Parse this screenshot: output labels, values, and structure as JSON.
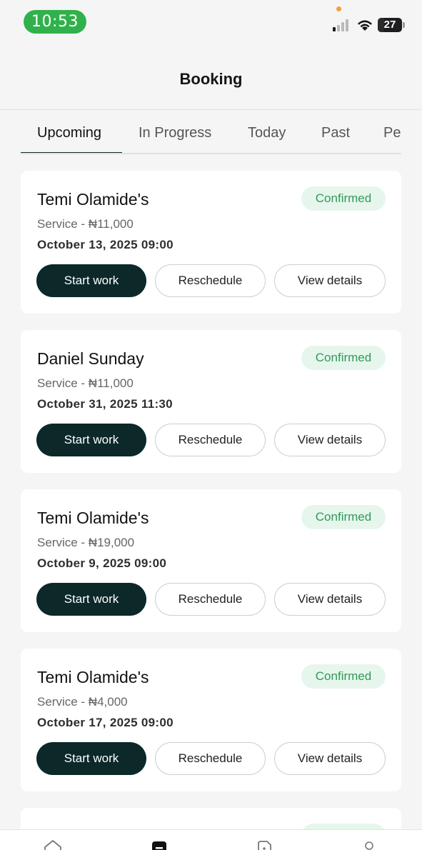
{
  "status_bar": {
    "time": "10:53",
    "battery": "27",
    "battery_fraction": 0.27
  },
  "header": {
    "title": "Booking"
  },
  "tabs": [
    {
      "label": "Upcoming",
      "active": true
    },
    {
      "label": "In Progress",
      "active": false
    },
    {
      "label": "Today",
      "active": false
    },
    {
      "label": "Past",
      "active": false
    },
    {
      "label": "Pending",
      "active": false
    }
  ],
  "bookings": [
    {
      "name": "Temi Olamide's",
      "status": "Confirmed",
      "service": "Service - ₦11,000",
      "datetime": "October 13, 2025 09:00",
      "start_label": "Start work",
      "reschedule_label": "Reschedule",
      "details_label": "View details"
    },
    {
      "name": "Daniel Sunday",
      "status": "Confirmed",
      "service": "Service - ₦11,000",
      "datetime": "October 31, 2025 11:30",
      "start_label": "Start work",
      "reschedule_label": "Reschedule",
      "details_label": "View details"
    },
    {
      "name": "Temi Olamide's",
      "status": "Confirmed",
      "service": "Service - ₦19,000",
      "datetime": "October 9, 2025 09:00",
      "start_label": "Start work",
      "reschedule_label": "Reschedule",
      "details_label": "View details"
    },
    {
      "name": "Temi Olamide's",
      "status": "Confirmed",
      "service": "Service - ₦4,000",
      "datetime": "October 17, 2025 09:00",
      "start_label": "Start work",
      "reschedule_label": "Reschedule",
      "details_label": "View details"
    }
  ],
  "bottom_nav": [
    {
      "icon": "home-icon",
      "active": false
    },
    {
      "icon": "booking-icon",
      "active": true
    },
    {
      "icon": "document-icon",
      "active": false
    },
    {
      "icon": "profile-icon",
      "active": false
    }
  ],
  "colors": {
    "accent": "#0c2829",
    "badge_bg": "#e6f6ec",
    "badge_text": "#32995a",
    "time_pill": "#30b14b"
  }
}
